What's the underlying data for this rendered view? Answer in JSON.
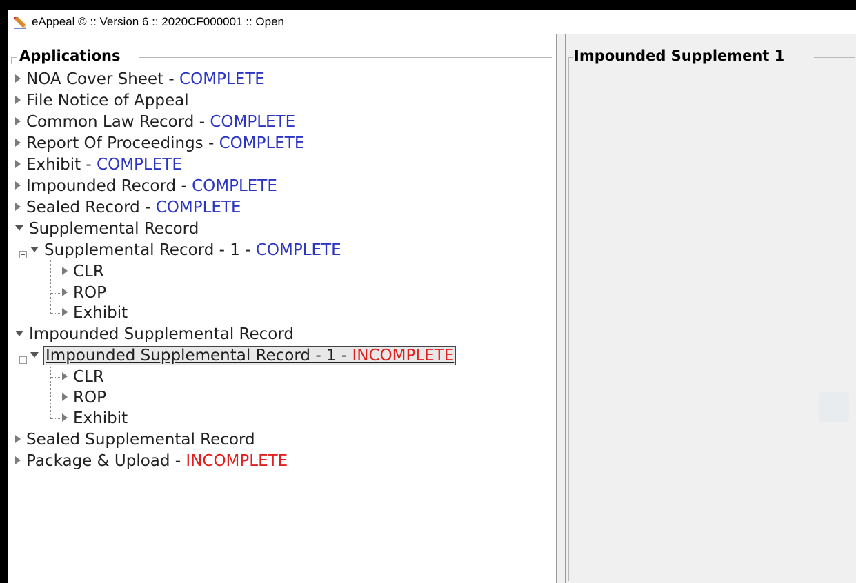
{
  "window": {
    "title": "eAppeal © :: Version 6 :: 2020CF000001 :: Open",
    "icon": "pencil-icon"
  },
  "left_panel": {
    "title": "Applications"
  },
  "right_panel": {
    "title": "Impounded Supplement 1"
  },
  "tree": {
    "items": [
      {
        "label": "NOA Cover Sheet",
        "status": "COMPLETE"
      },
      {
        "label": "File Notice of Appeal",
        "status": ""
      },
      {
        "label": "Common Law Record",
        "status": "COMPLETE"
      },
      {
        "label": "Report Of Proceedings",
        "status": "COMPLETE"
      },
      {
        "label": "Exhibit",
        "status": "COMPLETE"
      },
      {
        "label": "Impounded Record",
        "status": "COMPLETE"
      },
      {
        "label": "Sealed Record",
        "status": "COMPLETE"
      },
      {
        "label": "Supplemental Record",
        "status": ""
      },
      {
        "label": "Supplemental Record - 1",
        "status": "COMPLETE"
      },
      {
        "label": "CLR",
        "status": ""
      },
      {
        "label": "ROP",
        "status": ""
      },
      {
        "label": "Exhibit",
        "status": ""
      },
      {
        "label": "Impounded Supplemental Record",
        "status": ""
      },
      {
        "label": "Impounded Supplemental Record - 1",
        "status": "INCOMPLETE"
      },
      {
        "label": "CLR",
        "status": ""
      },
      {
        "label": "ROP",
        "status": ""
      },
      {
        "label": "Exhibit",
        "status": ""
      },
      {
        "label": "Sealed Supplemental Record",
        "status": ""
      },
      {
        "label": "Package & Upload",
        "status": "INCOMPLETE"
      }
    ],
    "separator": " - "
  },
  "colors": {
    "complete": "#2b35c2",
    "incomplete": "#e0201e"
  }
}
